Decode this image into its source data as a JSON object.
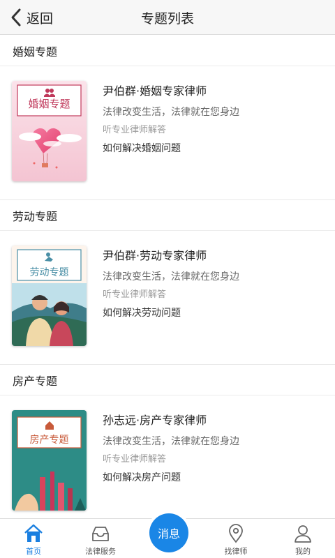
{
  "header": {
    "back_label": "返回",
    "title": "专题列表"
  },
  "sections": [
    {
      "heading": "婚姻专题",
      "cover_label": "婚姻专题",
      "lawyer": "尹伯群·婚姻专家律师",
      "slogan": "法律改变生活，法律就在您身边",
      "sub": "听专业律师解答",
      "question": "如何解决婚姻问题"
    },
    {
      "heading": "劳动专题",
      "cover_label": "劳动专题",
      "lawyer": "尹伯群·劳动专家律师",
      "slogan": "法律改变生活，法律就在您身边",
      "sub": "听专业律师解答",
      "question": "如何解决劳动问题"
    },
    {
      "heading": "房产专题",
      "cover_label": "房产专题",
      "lawyer": "孙志远·房产专家律师",
      "slogan": "法律改变生活，法律就在您身边",
      "sub": "听专业律师解答",
      "question": "如何解决房产问题"
    }
  ],
  "tabbar": {
    "home": "首页",
    "legal": "法律服务",
    "message": "消息",
    "find_lawyer": "找律师",
    "mine": "我的",
    "active": "home"
  },
  "colors": {
    "accent": "#1a86e6",
    "active_tab": "#1a7fe0"
  }
}
